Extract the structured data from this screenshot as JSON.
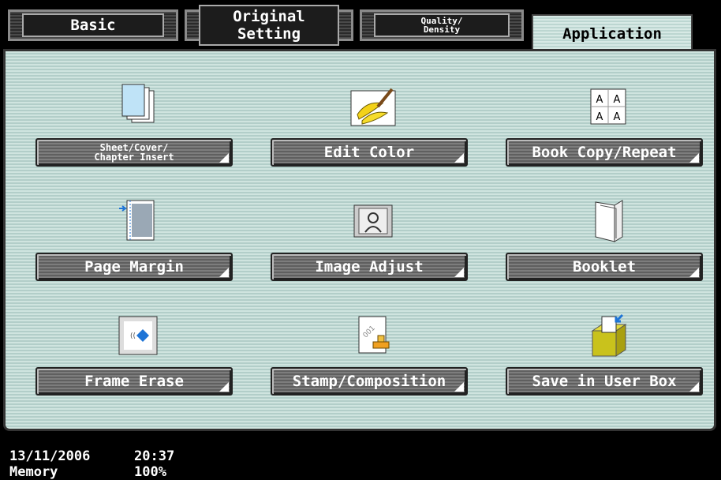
{
  "tabs": [
    {
      "label": "Basic"
    },
    {
      "label": "Original Setting"
    },
    {
      "label": "Quality/\nDensity"
    },
    {
      "label": "Application"
    }
  ],
  "functions": [
    {
      "label": "Sheet/Cover/\nChapter Insert",
      "icon": "sheet-insert-icon"
    },
    {
      "label": "Edit Color",
      "icon": "bananas-paintbrush-icon"
    },
    {
      "label": "Book Copy/Repeat",
      "icon": "repeat-a-icon"
    },
    {
      "label": "Page Margin",
      "icon": "page-margin-icon"
    },
    {
      "label": "Image Adjust",
      "icon": "image-adjust-icon"
    },
    {
      "label": "Booklet",
      "icon": "booklet-icon"
    },
    {
      "label": "Frame Erase",
      "icon": "frame-erase-icon"
    },
    {
      "label": "Stamp/Composition",
      "icon": "stamp-icon"
    },
    {
      "label": "Save in User Box",
      "icon": "user-box-icon"
    }
  ],
  "status": {
    "date": "13/11/2006",
    "time": "20:37",
    "memory_label": "Memory",
    "memory_value": "100%"
  },
  "colors": {
    "panel": "#c6ddd8",
    "button": "#6e6e6e",
    "accent": "#1e74d6"
  }
}
